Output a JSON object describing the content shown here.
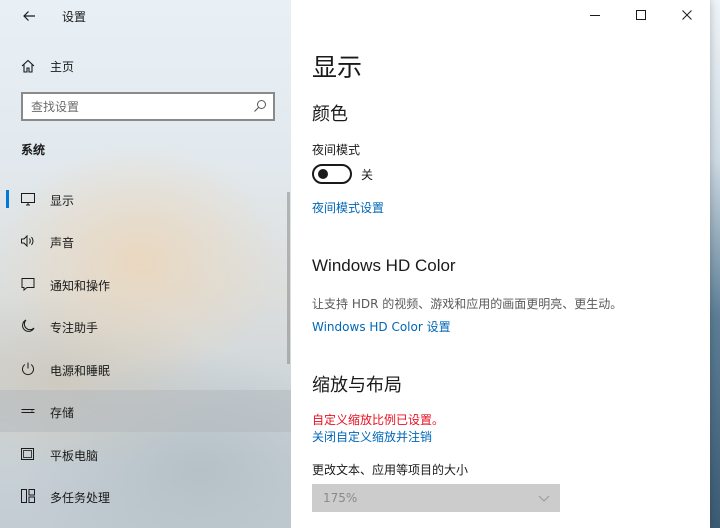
{
  "window": {
    "title": "设置",
    "controls": {
      "minimize": "minimize",
      "maximize": "maximize",
      "close": "close"
    }
  },
  "sidebar": {
    "home_label": "主页",
    "search_placeholder": "查找设置",
    "section_label": "系统",
    "items": [
      {
        "label": "显示",
        "icon": "monitor-icon",
        "state": "selected"
      },
      {
        "label": "声音",
        "icon": "speaker-icon",
        "state": "normal"
      },
      {
        "label": "通知和操作",
        "icon": "notification-icon",
        "state": "normal"
      },
      {
        "label": "专注助手",
        "icon": "moon-icon",
        "state": "normal"
      },
      {
        "label": "电源和睡眠",
        "icon": "power-icon",
        "state": "normal"
      },
      {
        "label": "存储",
        "icon": "storage-icon",
        "state": "hover"
      },
      {
        "label": "平板电脑",
        "icon": "tablet-icon",
        "state": "normal"
      },
      {
        "label": "多任务处理",
        "icon": "multitask-icon",
        "state": "normal"
      }
    ]
  },
  "main": {
    "page_title": "显示",
    "color_section": {
      "heading": "颜色",
      "night_light_label": "夜间模式",
      "toggle_state": "关",
      "toggle_on": false,
      "night_light_link": "夜间模式设置"
    },
    "hd_section": {
      "heading": "Windows HD Color",
      "description": "让支持 HDR 的视频、游戏和应用的画面更明亮、更生动。",
      "link": "Windows HD Color 设置"
    },
    "scale_section": {
      "heading": "缩放与布局",
      "warning": "自定义缩放比例已设置。",
      "off_link": "关闭自定义缩放并注销",
      "size_label": "更改文本、应用等项目的大小",
      "size_value": "175%",
      "size_enabled": false
    }
  },
  "colors": {
    "accent": "#0078d7",
    "link": "#0067b8",
    "warning": "#e81123"
  }
}
